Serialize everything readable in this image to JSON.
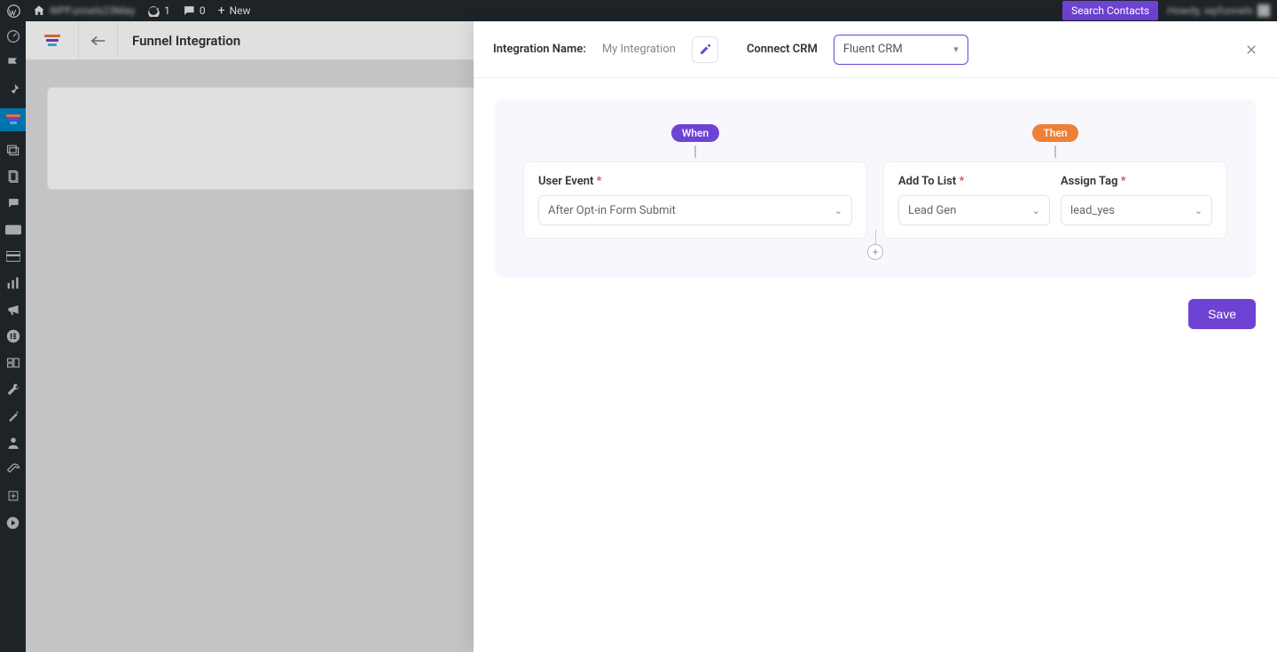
{
  "adminbar": {
    "site_name": "WPFunnels23May",
    "updates": "1",
    "comments": "0",
    "new": "New",
    "search_contacts": "Search Contacts",
    "howdy": "Howdy, wpfunnels"
  },
  "page": {
    "title": "Funnel Integration"
  },
  "panel": {
    "integration_name_label": "Integration Name:",
    "integration_name_value": "My Integration",
    "connect_crm_label": "Connect CRM",
    "connect_crm_value": "Fluent CRM"
  },
  "automation": {
    "when_label": "When",
    "then_label": "Then",
    "user_event_label": "User Event",
    "user_event_value": "After Opt-in Form Submit",
    "add_to_list_label": "Add To List",
    "add_to_list_value": "Lead Gen",
    "assign_tag_label": "Assign Tag",
    "assign_tag_value": "lead_yes",
    "required_mark": "*"
  },
  "save_label": "Save"
}
